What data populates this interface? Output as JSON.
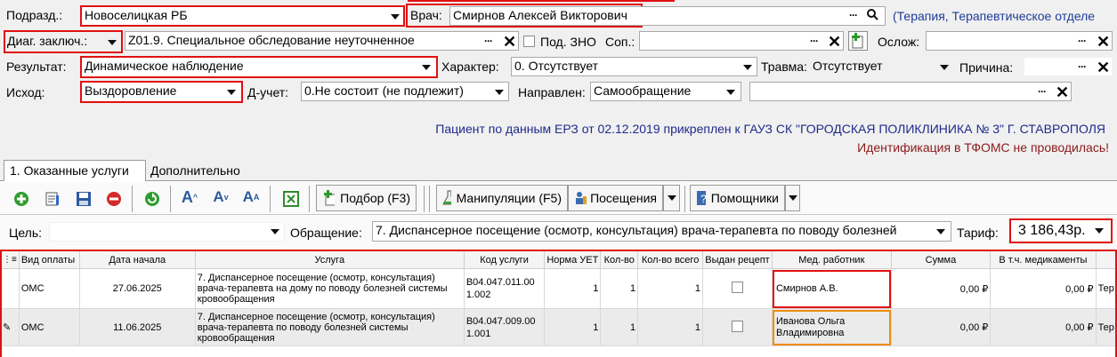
{
  "form": {
    "podrazd_label": "Подразд.:",
    "podrazd_value": "Новоселицкая РБ",
    "vrach_label": "Врач:",
    "vrach_value": "Смирнов Алексей Викторович",
    "vrach_note": "(Терапия, Терапевтическое отделе",
    "diag_label": "Диаг. заключ.:",
    "diag_value": "Z01.9. Специальное обследование неуточненное",
    "zno_label": "Под. ЗНО",
    "sop_label": "Соп.:",
    "sop_value": "",
    "oslozh_label": "Ослож:",
    "oslozh_value": "",
    "rezult_label": "Результат:",
    "rezult_value": "Динамическое наблюдение",
    "harakter_label": "Характер:",
    "harakter_value": "0. Отсутствует",
    "travma_label": "Травма:",
    "travma_value": "Отсутствует",
    "prichina_label": "Причина:",
    "prichina_value": "",
    "ishod_label": "Исход:",
    "ishod_value": "Выздоровление",
    "ducheat_label": "Д-учет:",
    "ducheat_value": "0.Не состоит (не подлежит)",
    "napravlen_label": "Направлен:",
    "napravlen_value": "Самообращение",
    "napravlen_extra": ""
  },
  "info": {
    "line1": "Пациент по данным ЕРЗ от 02.12.2019 прикреплен к ГАУЗ СК \"ГОРОДСКАЯ ПОЛИКЛИНИКА № 3\" Г. СТАВРОПОЛЯ",
    "line2": "Идентификация в ТФОМС не проводилась!"
  },
  "tabs": [
    "1. Оказанные услуги",
    "Дополнительно"
  ],
  "toolbar": {
    "podbor": "Подбор (F3)",
    "manipulyacii": "Манипуляции (F5)",
    "poseshcheniya": "Посещения",
    "pomoshchniki": "Помощники"
  },
  "filter": {
    "cel_label": "Цель:",
    "cel_value": "",
    "obrashchenie_label": "Обращение:",
    "obrashchenie_value": "7. Диспансерное посещение (осмотр, консультация) врача-терапевта по поводу болезней",
    "tarif_label": "Тариф:",
    "tarif_value": "3 186,43р."
  },
  "grid": {
    "columns": [
      "Вид оплаты",
      "Дата начала",
      "Услуга",
      "Код услуги",
      "Норма УЕТ",
      "Кол-во",
      "Кол-во всего",
      "Выдан рецепт",
      "Мед. работник",
      "Сумма",
      "В т.ч. медикаменты",
      ""
    ],
    "rows": [
      {
        "vid": "ОМС",
        "date": "27.06.2025",
        "usluga": "7. Диспансерное посещение (осмотр, консультация) врача-терапевта на дому по поводу болезней системы кровообращения",
        "kod": "B04.047.011.001.002",
        "norma": "1",
        "kol": "1",
        "kol_vsego": "1",
        "recept": false,
        "med": "Смирнов А.В.",
        "summa": "0,00 ₽",
        "med_sum": "0,00 ₽",
        "extra": "Тер"
      },
      {
        "vid": "ОМС",
        "date": "11.06.2025",
        "usluga": "7. Диспансерное посещение (осмотр, консультация) врача-терапевта по поводу болезней системы кровообращения",
        "kod": "B04.047.009.001.001",
        "norma": "1",
        "kol": "1",
        "kol_vsego": "1",
        "recept": false,
        "med": "Иванова Ольга Владимировна",
        "summa": "0,00 ₽",
        "med_sum": "0,00 ₽",
        "extra": "Тер"
      }
    ]
  },
  "colors": {
    "highlight_red": "#e01010",
    "highlight_orange": "#f08c10",
    "info_blue": "#1f2a8a",
    "info_red": "#8b1a1a"
  }
}
